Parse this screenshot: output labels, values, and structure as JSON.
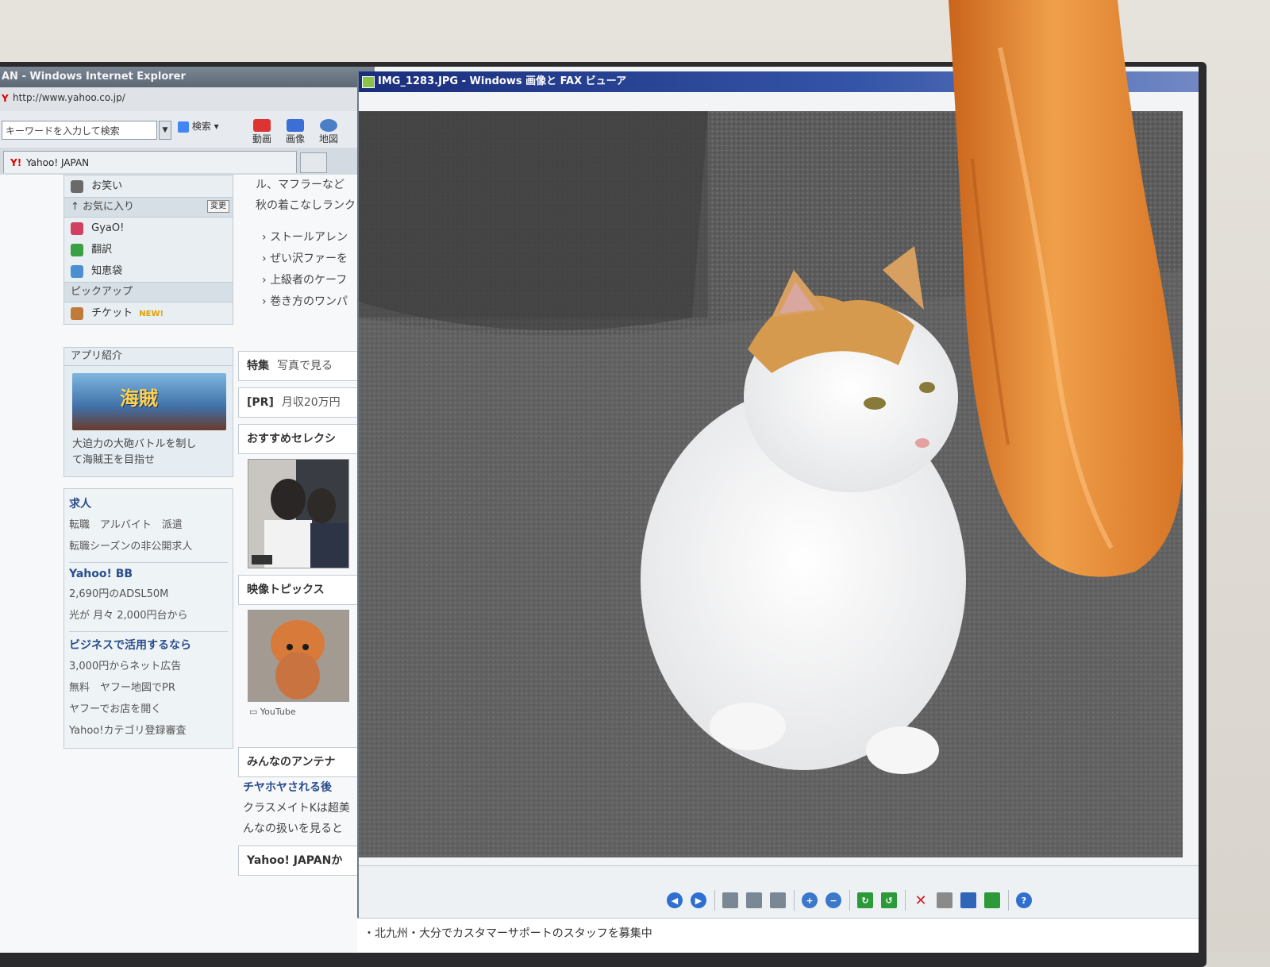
{
  "ie": {
    "title": "AN - Windows Internet Explorer",
    "address": "http://www.yahoo.co.jp/",
    "search_placeholder": "キーワードを入力して検索",
    "search_button": "検索",
    "toolbar": [
      {
        "label": "動画",
        "icon": "youtube-icon",
        "color": "#d33"
      },
      {
        "label": "画像",
        "icon": "image-icon",
        "color": "#3b6fd6"
      },
      {
        "label": "地図",
        "icon": "compass-icon",
        "color": "#4a7fc8"
      }
    ],
    "tab_label": "Yahoo! JAPAN"
  },
  "sidebar": {
    "items_top": [
      {
        "label": "お笑い",
        "icon": "comedy-icon",
        "color": "#6a6a6a"
      }
    ],
    "favorites_label": "お気に入り",
    "favorites_change": "変更",
    "items": [
      {
        "label": "GyaO!",
        "icon": "gyao-icon",
        "color": "#d04060"
      },
      {
        "label": "翻訳",
        "icon": "translate-icon",
        "color": "#3aa043"
      },
      {
        "label": "知恵袋",
        "icon": "chiebukuro-icon",
        "color": "#4a90d0"
      }
    ],
    "pickup_label": "ピックアップ",
    "ticket_label": "チケット",
    "ticket_new": "NEW!"
  },
  "app": {
    "head": "アプリ紹介",
    "banner_logo": "海賊",
    "desc_line1": "大迫力の大砲バトルを制し",
    "desc_line2": "て海賊王を目指せ"
  },
  "ads": {
    "job_title": "求人",
    "job_line1": "転職　アルバイト　派遣",
    "job_line2": "転職シーズンの非公開求人",
    "bb_title": "Yahoo! BB",
    "bb_line1": "2,690円のADSL50M",
    "bb_line2": "光が 月々 2,000円台から",
    "biz_title": "ビジネスで活用するなら",
    "biz_line1": "3,000円からネット広告",
    "biz_line2": "無料　ヤフー地図でPR",
    "biz_line3": "ヤフーでお店を開く",
    "biz_line4": "Yahoo!カテゴリ登録審査"
  },
  "middle": {
    "top_line1": "ル、マフラーなど",
    "top_line2": "秋の着こなしランク",
    "bullets": [
      "ストールアレン",
      "ぜい沢ファーを",
      "上級者のケーフ",
      "巻き方のワンパ"
    ],
    "feature_label": "特集",
    "feature_text": "写真で見る",
    "pr_label": "[PR]",
    "pr_text": "月収20万円",
    "recommend_label": "おすすめセレクシ",
    "video_topics": "映像トピックス",
    "youtube_label": "YouTube",
    "antenna_label": "みんなのアンテナ",
    "antenna_title": "チヤホヤされる後",
    "antenna_line1": "クラスメイトKは超美",
    "antenna_line2": "んなの扱いを見ると",
    "yahoo_japan_label": "Yahoo! JAPANか"
  },
  "viewer": {
    "title": "IMG_1283.JPG - Windows 画像と FAX ビューア",
    "status": "・北九州・大分でカスタマーサポートのスタッフを募集中",
    "tools": [
      {
        "icon": "previous-image-icon",
        "color": "#2f6fd0"
      },
      {
        "icon": "next-image-icon",
        "color": "#2f6fd0"
      },
      {
        "icon": "best-fit-icon",
        "color": "#7a8896"
      },
      {
        "icon": "actual-size-icon",
        "color": "#7a8896"
      },
      {
        "icon": "slideshow-icon",
        "color": "#7a8896"
      },
      {
        "icon": "zoom-in-icon",
        "color": "#3b78c9"
      },
      {
        "icon": "zoom-out-icon",
        "color": "#3b78c9"
      },
      {
        "icon": "rotate-clockwise-icon",
        "color": "#2d9a3a"
      },
      {
        "icon": "rotate-counterclockwise-icon",
        "color": "#2d9a3a"
      },
      {
        "icon": "delete-icon",
        "color": "#d02020"
      },
      {
        "icon": "print-icon",
        "color": "#8a8a8a"
      },
      {
        "icon": "save-icon",
        "color": "#3066b8"
      },
      {
        "icon": "open-with-icon",
        "color": "#2d9a3a"
      },
      {
        "icon": "help-icon",
        "color": "#2f6fd0"
      }
    ]
  }
}
